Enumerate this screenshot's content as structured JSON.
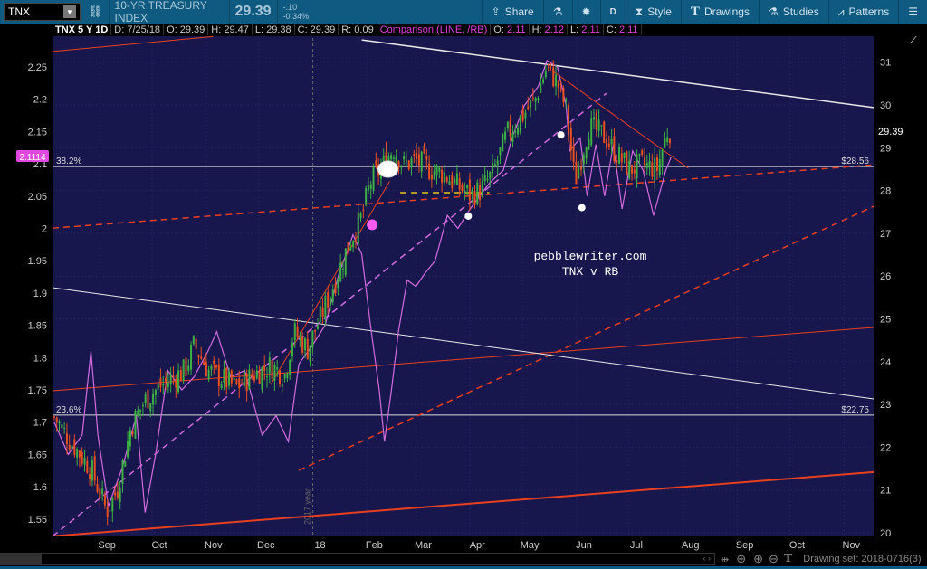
{
  "toolbar": {
    "symbol": "TNX",
    "description": "10-YR TREASURY INDEX",
    "last": "29.39",
    "change": "-.10",
    "change_pct": "-0.34%",
    "share": "Share",
    "period": "D",
    "style": "Style",
    "drawings": "Drawings",
    "studies": "Studies",
    "patterns": "Patterns"
  },
  "info": {
    "title": "TNX 5 Y 1D",
    "date": "D: 7/25/18",
    "open": "O: 29.39",
    "high": "H: 29.47",
    "low": "L: 29.38",
    "close": "C: 29.39",
    "range": "R: 0.09",
    "comparison": "Comparison (LINE, /RB)",
    "c_open_l": "O:",
    "c_open": "2.11",
    "c_high_l": "H:",
    "c_high": "2.12",
    "c_low_l": "L:",
    "c_low": "2.11",
    "c_close_l": "C:",
    "c_close": "2.11"
  },
  "bottom": {
    "drawing_set": "Drawing set: 2018-0716(3)"
  },
  "colors": {
    "bg": "#17164d",
    "up": "#3cb043",
    "down": "#e8501e",
    "comparison": "#d36be0",
    "drawing_red": "#e8401e",
    "white": "#e8e8e8",
    "yellow": "#e6c619"
  },
  "chart_data": {
    "type": "candlestick+line",
    "title": "TNX 5 Y 1D",
    "xlabel": "",
    "ylabel": "",
    "x_unit": "days since 2017-08-05",
    "right_axis": {
      "series": "TNX",
      "ylim": [
        20,
        31
      ],
      "ticks": [
        20,
        21,
        22,
        23,
        24,
        25,
        26,
        27,
        28,
        29,
        30,
        31
      ],
      "last_label": "29.39"
    },
    "left_axis": {
      "series": "/RB",
      "ylim": [
        1.55,
        2.25
      ],
      "ticks": [
        "2.25",
        "2.2",
        "2.15",
        "2.1",
        "2.05",
        "2",
        "1.95",
        "1.9",
        "1.85",
        "1.8",
        "1.75",
        "1.7",
        "1.65",
        "1.6",
        "1.55"
      ],
      "last_label": "2.1114"
    },
    "x_ticks": [
      {
        "label": "Sep",
        "day": 27
      },
      {
        "label": "Oct",
        "day": 57
      },
      {
        "label": "Nov",
        "day": 88
      },
      {
        "label": "Dec",
        "day": 118
      },
      {
        "label": "18",
        "day": 149
      },
      {
        "label": "Feb",
        "day": 180
      },
      {
        "label": "Mar",
        "day": 208
      },
      {
        "label": "Apr",
        "day": 239
      },
      {
        "label": "May",
        "day": 269
      },
      {
        "label": "Jun",
        "day": 300
      },
      {
        "label": "Jul",
        "day": 330
      },
      {
        "label": "Aug",
        "day": 361
      },
      {
        "label": "Sep",
        "day": 392
      },
      {
        "label": "Oct",
        "day": 422
      },
      {
        "label": "Nov",
        "day": 453
      }
    ],
    "tnx_close": {
      "day": [
        1,
        11,
        22,
        31,
        37,
        45,
        53,
        61,
        68,
        76,
        81,
        89,
        97,
        105,
        115,
        125,
        133,
        138,
        146,
        154,
        162,
        169,
        177,
        182,
        188,
        195,
        201,
        208,
        216,
        224,
        232,
        239,
        245,
        252,
        260,
        268,
        276,
        283,
        289,
        294,
        299,
        307,
        315,
        322,
        330,
        338,
        346,
        352,
        354
      ],
      "value": [
        22.7,
        22.1,
        21.5,
        20.5,
        21.0,
        22.5,
        23.1,
        23.4,
        23.6,
        23.8,
        24.4,
        23.8,
        23.6,
        23.4,
        23.7,
        23.9,
        23.7,
        24.7,
        24.3,
        25.1,
        25.9,
        26.7,
        27.4,
        28.2,
        28.5,
        29.0,
        28.6,
        28.7,
        28.5,
        28.4,
        28.1,
        27.9,
        28.0,
        28.4,
        29.3,
        29.7,
        30.1,
        30.9,
        30.5,
        29.9,
        28.2,
        29.5,
        29.3,
        28.9,
        28.5,
        28.6,
        28.5,
        29.4,
        29.39
      ]
    },
    "rb_comparison": {
      "day": [
        1,
        9,
        17,
        22,
        26,
        32,
        40,
        48,
        53,
        59,
        66,
        74,
        81,
        89,
        94,
        102,
        110,
        120,
        128,
        135,
        141,
        149,
        156,
        164,
        172,
        177,
        182,
        187,
        190,
        194,
        198,
        203,
        208,
        213,
        219,
        226,
        232,
        239,
        250,
        258,
        263,
        270,
        278,
        283,
        289,
        294,
        296,
        302,
        306,
        311,
        316,
        321,
        326,
        332,
        338,
        344,
        351,
        354
      ],
      "value": [
        1.7,
        1.65,
        1.68,
        1.81,
        1.68,
        1.57,
        1.63,
        1.71,
        1.56,
        1.65,
        1.78,
        1.75,
        1.77,
        1.81,
        1.84,
        1.77,
        1.78,
        1.68,
        1.71,
        1.67,
        1.79,
        1.82,
        1.85,
        1.93,
        1.99,
        1.96,
        1.85,
        1.75,
        1.67,
        1.75,
        1.84,
        1.92,
        1.91,
        1.93,
        1.95,
        2.02,
        2.0,
        2.03,
        2.07,
        2.09,
        2.14,
        2.19,
        2.22,
        2.26,
        2.25,
        2.19,
        2.12,
        2.14,
        2.05,
        2.13,
        2.05,
        2.13,
        2.03,
        2.12,
        2.09,
        2.02,
        2.09,
        2.11
      ]
    },
    "fib_levels": [
      {
        "label": "38.2%",
        "price_label": "$28.56",
        "value": 28.56
      },
      {
        "label": "23.6%",
        "price_label": "$22.75",
        "value": 22.75
      }
    ],
    "trendlines": [
      {
        "name": "red-upper-left",
        "style": "solid-thin",
        "color": "red",
        "from": [
          0,
          31.25
        ],
        "to": [
          92,
          31.6
        ]
      },
      {
        "name": "white-resistance",
        "style": "solid",
        "color": "white",
        "from": [
          177,
          31.52
        ],
        "to": [
          470,
          29.94
        ]
      },
      {
        "name": "red-dashed-support",
        "style": "dashed",
        "color": "red",
        "from": [
          0,
          27.12
        ],
        "to": [
          470,
          28.6
        ]
      },
      {
        "name": "red-dashed-rising",
        "style": "dashed",
        "color": "red",
        "from": [
          141,
          21.46
        ],
        "to": [
          470,
          27.63
        ]
      },
      {
        "name": "red-thin-mid",
        "style": "solid-thin",
        "color": "red",
        "from": [
          0,
          23.32
        ],
        "to": [
          470,
          24.8
        ]
      },
      {
        "name": "white-thin-mid",
        "style": "solid-thin",
        "color": "white",
        "from": [
          0,
          25.73
        ],
        "to": [
          470,
          23.13
        ]
      },
      {
        "name": "red-bottom",
        "style": "solid-thick",
        "color": "red",
        "from": [
          0,
          19.92
        ],
        "to": [
          470,
          21.42
        ]
      },
      {
        "name": "magenta-dashed-channel",
        "style": "dashed",
        "color": "magenta",
        "from": [
          0,
          19.92
        ],
        "to": [
          317,
          30.27
        ]
      },
      {
        "name": "red-steep-trend",
        "style": "solid-thin",
        "color": "red",
        "from": [
          125,
          23.47
        ],
        "to": [
          193,
          28.22
        ]
      },
      {
        "name": "red-down-trend",
        "style": "solid-thin",
        "color": "red",
        "from": [
          286,
          30.8
        ],
        "to": [
          364,
          28.52
        ]
      },
      {
        "name": "yellow-dashed",
        "style": "dashed",
        "color": "yellow",
        "from": [
          199,
          27.95
        ],
        "to": [
          250,
          27.95
        ]
      }
    ],
    "markers": [
      {
        "color": "white",
        "day": 192,
        "value": 28.5,
        "shape": "ellipse"
      },
      {
        "color": "magenta",
        "day": 183,
        "value": 27.2,
        "shape": "circle"
      },
      {
        "color": "white",
        "day": 238,
        "value": 27.4,
        "shape": "dot"
      },
      {
        "color": "white",
        "day": 291,
        "value": 29.3,
        "shape": "dot"
      },
      {
        "color": "white",
        "day": 303,
        "value": 27.6,
        "shape": "dot"
      }
    ],
    "year_marker": {
      "label": "2017 year",
      "day": 149
    },
    "annotation": [
      "pebblewriter.com",
      "TNX v RB"
    ]
  }
}
